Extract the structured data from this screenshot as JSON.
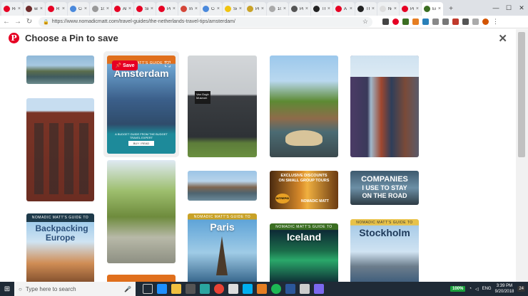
{
  "tabs": [
    {
      "label": "Rob",
      "color": "#e60023"
    },
    {
      "label": "win",
      "color": "#6d2b2b"
    },
    {
      "label": "R",
      "color": "#e60023"
    },
    {
      "label": "Co",
      "color": "#4a89dc"
    },
    {
      "label": "10",
      "color": "#999999"
    },
    {
      "label": "All",
      "color": "#e60023"
    },
    {
      "label": "Sn",
      "color": "#e60023"
    },
    {
      "label": "Pi",
      "color": "#e60023"
    },
    {
      "label": "Inb",
      "color": "#d44638"
    },
    {
      "label": "Co",
      "color": "#4a89dc"
    },
    {
      "label": "Sci",
      "color": "#f1c40f"
    },
    {
      "label": "Pin",
      "color": "#c9a227"
    },
    {
      "label": "10",
      "color": "#aaaaaa"
    },
    {
      "label": "Pin",
      "color": "#555555"
    },
    {
      "label": "Th",
      "color": "#222222"
    },
    {
      "label": "A L",
      "color": "#e60023"
    },
    {
      "label": "Th",
      "color": "#222222"
    },
    {
      "label": "New Ta",
      "color": "#dddddd"
    },
    {
      "label": "Pin",
      "color": "#e60023"
    },
    {
      "label": "Eur",
      "color": "#3b6e22"
    }
  ],
  "window": {
    "minimize": "—",
    "maximize": "☐",
    "close": "✕"
  },
  "addressbar": {
    "url": "https://www.nomadicmatt.com/travel-guides/the-netherlands-travel-tips/amsterdam/"
  },
  "modal": {
    "title": "Choose a Pin to save",
    "close": "✕",
    "save_label": "Save"
  },
  "pins": {
    "p2_top": "NOMADIC MATT'S GUIDE TO",
    "p2_title": "Amsterdam",
    "p2_sub": "A BUDGET GUIDE FROM THE BUDGET TRAVEL EXPERT",
    "p2_btn": "BUY / READ",
    "museum_sign": "Van Gogh Museum",
    "p9_line1": "EXCLUSIVE DISCOUNTS",
    "p9_line2": "ON SMALL GROUP TOURS",
    "p9_brand1": "INTREPID",
    "p9_brand2": "NOMADIC MATT",
    "p10_line1": "COMPANIES",
    "p10_line2": "I USE TO STAY",
    "p10_line3": "ON THE ROAD",
    "guide_top": "NOMADIC MATT'S GUIDE TO",
    "backpacking": "Backpacking Europe",
    "paris": "Paris",
    "iceland": "Iceland",
    "stockholm": "Stockholm"
  },
  "taskbar": {
    "search_placeholder": "Type here to search",
    "battery": "100%",
    "lang": "ENG",
    "time": "3:39 PM",
    "date": "9/20/2018",
    "notif": "24"
  }
}
